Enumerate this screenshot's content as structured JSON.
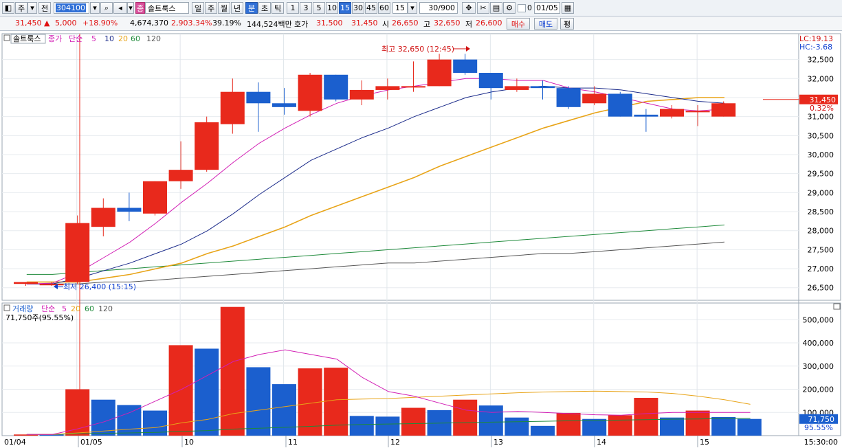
{
  "toolbar": {
    "tabs": [
      "주",
      "전"
    ],
    "code": "304100",
    "stock_badge": "종",
    "stock_name": "솔트룩스",
    "periods": [
      "일",
      "주",
      "월",
      "년",
      "분",
      "초",
      "틱"
    ],
    "active_period": "분",
    "minutes": [
      "1",
      "3",
      "5",
      "10",
      "15",
      "30",
      "45",
      "60"
    ],
    "active_minute": "15",
    "minute_select": "15",
    "count": "30/900",
    "flag_label": "0",
    "date": "01/05"
  },
  "quote": {
    "price": "31,450",
    "change": "5,000",
    "change_pct": "+18.90%",
    "volume": "4,674,370",
    "volume_pct": "2,903.34%",
    "turnover": "39.19%",
    "amount": "144,524백만",
    "ask_label": "호가",
    "ask": "31,500",
    "bid": "31,450",
    "open_label": "시",
    "open": "26,650",
    "high_label": "고",
    "high": "32,650",
    "low_label": "저",
    "low": "26,600",
    "buy_label": "매수",
    "sell_label": "매도",
    "eval_label": "평"
  },
  "colors": {
    "up": "#e8291c",
    "down": "#1b5fce",
    "ma5": "#d21fb5",
    "ma10": "#1a2a8a",
    "ma20": "#e8a418",
    "ma60": "#1e8a3a",
    "ma120": "#555555"
  },
  "chart_data": [
    {
      "type": "candlestick",
      "panel": "price",
      "legend": {
        "name": "솔트룩스",
        "price_label": "종가",
        "method": "단순",
        "periods": [
          "5",
          "10",
          "20",
          "60",
          "120"
        ]
      },
      "y_ticks": [
        26500,
        27000,
        27500,
        28000,
        28500,
        29000,
        29500,
        30000,
        30500,
        31000,
        31500,
        32000,
        32500
      ],
      "ylim": [
        26170,
        33180
      ],
      "x_labels": [
        "01/04",
        "01/05",
        "10",
        "11",
        "12",
        "13",
        "14",
        "15",
        "15:30:00"
      ],
      "candles": [
        {
          "o": 26600,
          "c": 26650,
          "h": 26650,
          "l": 26550
        },
        {
          "o": 26600,
          "c": 26600,
          "h": 26650,
          "l": 26550
        },
        {
          "o": 26650,
          "c": 28200,
          "h": 28400,
          "l": 26600
        },
        {
          "o": 28100,
          "c": 28600,
          "h": 28850,
          "l": 27850
        },
        {
          "o": 28600,
          "c": 28500,
          "h": 29000,
          "l": 28250
        },
        {
          "o": 28450,
          "c": 29300,
          "h": 29300,
          "l": 28400
        },
        {
          "o": 29300,
          "c": 29600,
          "h": 30350,
          "l": 29100
        },
        {
          "o": 29600,
          "c": 30850,
          "h": 31000,
          "l": 29550
        },
        {
          "o": 30800,
          "c": 31650,
          "h": 32000,
          "l": 30550
        },
        {
          "o": 31650,
          "c": 31350,
          "h": 31900,
          "l": 30600
        },
        {
          "o": 31350,
          "c": 31250,
          "h": 31750,
          "l": 31050
        },
        {
          "o": 31150,
          "c": 32100,
          "h": 32150,
          "l": 31000
        },
        {
          "o": 32100,
          "c": 31450,
          "h": 32100,
          "l": 31400
        },
        {
          "o": 31450,
          "c": 31700,
          "h": 31950,
          "l": 31300
        },
        {
          "o": 31700,
          "c": 31800,
          "h": 32000,
          "l": 31450
        },
        {
          "o": 31800,
          "c": 31800,
          "h": 32450,
          "l": 31650
        },
        {
          "o": 31800,
          "c": 32500,
          "h": 32650,
          "l": 31800
        },
        {
          "o": 32500,
          "c": 32150,
          "h": 32650,
          "l": 32100
        },
        {
          "o": 32150,
          "c": 31750,
          "h": 32150,
          "l": 31450
        },
        {
          "o": 31700,
          "c": 31800,
          "h": 32000,
          "l": 31650
        },
        {
          "o": 31800,
          "c": 31750,
          "h": 31950,
          "l": 31450
        },
        {
          "o": 31750,
          "c": 31250,
          "h": 31800,
          "l": 31200
        },
        {
          "o": 31350,
          "c": 31600,
          "h": 31800,
          "l": 31300
        },
        {
          "o": 31600,
          "c": 31000,
          "h": 31650,
          "l": 31000
        },
        {
          "o": 31050,
          "c": 31000,
          "h": 31200,
          "l": 30600
        },
        {
          "o": 31000,
          "c": 31200,
          "h": 31300,
          "l": 30950
        },
        {
          "o": 31150,
          "c": 31150,
          "h": 31300,
          "l": 30750
        },
        {
          "o": 31000,
          "c": 31350,
          "h": 31400,
          "l": 31000
        }
      ],
      "ma5": [
        26600,
        26620,
        26900,
        27300,
        27700,
        28200,
        28750,
        29250,
        29800,
        30300,
        30700,
        31050,
        31350,
        31550,
        31700,
        31800,
        31900,
        32000,
        32000,
        31950,
        31950,
        31750,
        31650,
        31500,
        31350,
        31200,
        31150,
        31200
      ],
      "ma10": [
        26600,
        26600,
        26750,
        26950,
        27150,
        27400,
        27650,
        28000,
        28450,
        28950,
        29400,
        29850,
        30150,
        30450,
        30700,
        31000,
        31250,
        31500,
        31650,
        31750,
        31800,
        31750,
        31750,
        31700,
        31600,
        31500,
        31400,
        31350
      ],
      "ma20": [
        26650,
        26650,
        26650,
        26750,
        26850,
        27000,
        27150,
        27400,
        27600,
        27850,
        28100,
        28400,
        28650,
        28900,
        29150,
        29400,
        29700,
        29950,
        30200,
        30450,
        30700,
        30900,
        31100,
        31250,
        31400,
        31450,
        31500,
        31500
      ],
      "ma60": [
        26850,
        26850,
        26900,
        26950,
        27000,
        27050,
        27100,
        27150,
        27200,
        27250,
        27300,
        27350,
        27400,
        27450,
        27500,
        27550,
        27600,
        27650,
        27700,
        27750,
        27800,
        27850,
        27900,
        27950,
        28000,
        28050,
        28100,
        28150
      ],
      "ma120": [
        26600,
        26600,
        26600,
        26650,
        26650,
        26700,
        26750,
        26800,
        26850,
        26900,
        26950,
        27000,
        27050,
        27100,
        27150,
        27150,
        27200,
        27250,
        27300,
        27350,
        27400,
        27400,
        27450,
        27500,
        27550,
        27600,
        27650,
        27700
      ],
      "annotations": {
        "high": "최고 32,650 (12:45)",
        "low": "최저 26,400 (15:15)",
        "lc": "LC:19.13",
        "hc": "HC:-3.68",
        "last_price": "31,450",
        "last_pct": "0.32%"
      }
    },
    {
      "type": "bar",
      "panel": "volume",
      "legend": {
        "name": "거래량",
        "method": "단순",
        "periods": [
          "5",
          "20",
          "60",
          "120"
        ]
      },
      "current": "71,750주(95.55%)",
      "y_ticks": [
        100000,
        200000,
        300000,
        400000,
        500000
      ],
      "ylim": [
        0,
        560000
      ],
      "last_volume": "71,750",
      "last_pct": "95.55%",
      "volumes": [
        5000,
        5000,
        200000,
        155000,
        132000,
        108000,
        390000,
        375000,
        555000,
        295000,
        222000,
        290000,
        293000,
        85000,
        82000,
        120000,
        110000,
        155000,
        130000,
        78000,
        42000,
        98000,
        72000,
        88000,
        163000,
        78000,
        108000,
        80000,
        72000
      ],
      "up": [
        true,
        false,
        true,
        false,
        false,
        false,
        true,
        false,
        true,
        false,
        false,
        true,
        true,
        false,
        false,
        true,
        false,
        true,
        false,
        false,
        false,
        true,
        false,
        true,
        true,
        false,
        true,
        false,
        false
      ],
      "ma5": [
        5000,
        5000,
        30000,
        60000,
        100000,
        150000,
        200000,
        260000,
        320000,
        350000,
        370000,
        350000,
        330000,
        250000,
        190000,
        170000,
        140000,
        110000,
        100000,
        105000,
        100000,
        95000,
        90000,
        88000,
        95000,
        100000,
        100000,
        100000,
        100000
      ],
      "ma20": [
        5000,
        5000,
        12000,
        20000,
        28000,
        35000,
        55000,
        70000,
        95000,
        110000,
        125000,
        140000,
        155000,
        158000,
        160000,
        165000,
        170000,
        175000,
        180000,
        185000,
        188000,
        190000,
        192000,
        190000,
        188000,
        182000,
        170000,
        155000,
        135000
      ],
      "ma60": [
        5000,
        5000,
        8000,
        10000,
        12000,
        14000,
        18000,
        22000,
        28000,
        32000,
        36000,
        40000,
        45000,
        48000,
        50000,
        52000,
        54000,
        56000,
        58000,
        60000,
        62000,
        64000,
        65000,
        67000,
        69000,
        71000,
        72000,
        74000,
        75000
      ]
    }
  ]
}
